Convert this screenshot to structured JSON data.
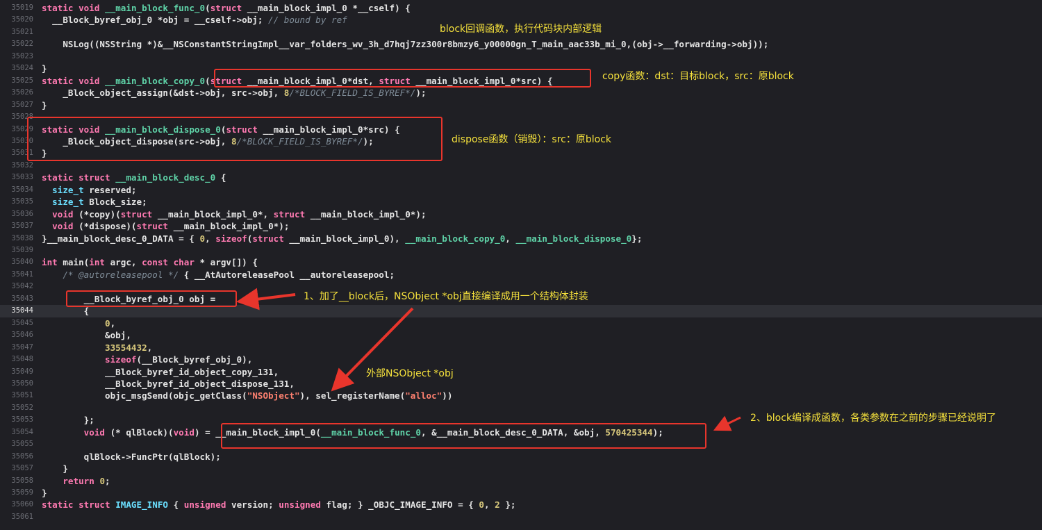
{
  "editor": {
    "current_line": "35044",
    "lines": [
      {
        "num": "35019",
        "code": "static void __main_block_func_0(struct __main_block_impl_0 *__cself) {"
      },
      {
        "num": "35020",
        "code": "  __Block_byref_obj_0 *obj = __cself->obj; // bound by ref"
      },
      {
        "num": "35021",
        "code": ""
      },
      {
        "num": "35022",
        "code": "    NSLog((NSString *)&__NSConstantStringImpl__var_folders_wv_3h_d7hqj7zz300r8bmzy6_y00000gn_T_main_aac33b_mi_0,(obj->__forwarding->obj));"
      },
      {
        "num": "35023",
        "code": ""
      },
      {
        "num": "35024",
        "code": "}"
      },
      {
        "num": "35025",
        "code": "static void __main_block_copy_0(struct __main_block_impl_0*dst, struct __main_block_impl_0*src) {"
      },
      {
        "num": "35026",
        "code": "    _Block_object_assign(&dst->obj, src->obj, 8/*BLOCK_FIELD_IS_BYREF*/);"
      },
      {
        "num": "35027",
        "code": "}"
      },
      {
        "num": "35028",
        "code": ""
      },
      {
        "num": "35029",
        "code": "static void __main_block_dispose_0(struct __main_block_impl_0*src) {"
      },
      {
        "num": "35030",
        "code": "    _Block_object_dispose(src->obj, 8/*BLOCK_FIELD_IS_BYREF*/);"
      },
      {
        "num": "35031",
        "code": "}"
      },
      {
        "num": "35032",
        "code": ""
      },
      {
        "num": "35033",
        "code": "static struct __main_block_desc_0 {"
      },
      {
        "num": "35034",
        "code": "  size_t reserved;"
      },
      {
        "num": "35035",
        "code": "  size_t Block_size;"
      },
      {
        "num": "35036",
        "code": "  void (*copy)(struct __main_block_impl_0*, struct __main_block_impl_0*);"
      },
      {
        "num": "35037",
        "code": "  void (*dispose)(struct __main_block_impl_0*);"
      },
      {
        "num": "35038",
        "code": "}__main_block_desc_0_DATA = { 0, sizeof(struct __main_block_impl_0), __main_block_copy_0, __main_block_dispose_0};"
      },
      {
        "num": "35039",
        "code": ""
      },
      {
        "num": "35040",
        "code": "int main(int argc, const char * argv[]) {"
      },
      {
        "num": "35041",
        "code": "    /* @autoreleasepool */ { __AtAutoreleasePool __autoreleasepool;"
      },
      {
        "num": "35042",
        "code": ""
      },
      {
        "num": "35043",
        "code": "        __Block_byref_obj_0 obj ="
      },
      {
        "num": "35044",
        "code": "        {"
      },
      {
        "num": "35045",
        "code": "            0,"
      },
      {
        "num": "35046",
        "code": "            &obj,"
      },
      {
        "num": "35047",
        "code": "            33554432,"
      },
      {
        "num": "35048",
        "code": "            sizeof(__Block_byref_obj_0),"
      },
      {
        "num": "35049",
        "code": "            __Block_byref_id_object_copy_131,"
      },
      {
        "num": "35050",
        "code": "            __Block_byref_id_object_dispose_131,"
      },
      {
        "num": "35051",
        "code": "            objc_msgSend(objc_getClass(\"NSObject\"), sel_registerName(\"alloc\"))"
      },
      {
        "num": "35052",
        "code": ""
      },
      {
        "num": "35053",
        "code": "        };"
      },
      {
        "num": "35054",
        "code": "        void (* qlBlock)(void) = __main_block_impl_0(__main_block_func_0, &__main_block_desc_0_DATA, &obj, 570425344);"
      },
      {
        "num": "35055",
        "code": ""
      },
      {
        "num": "35056",
        "code": "        qlBlock->FuncPtr(qlBlock);"
      },
      {
        "num": "35057",
        "code": "    }"
      },
      {
        "num": "35058",
        "code": "    return 0;"
      },
      {
        "num": "35059",
        "code": "}"
      },
      {
        "num": "35060",
        "code": "static struct IMAGE_INFO { unsigned version; unsigned flag; } _OBJC_IMAGE_INFO = { 0, 2 };"
      },
      {
        "num": "35061",
        "code": ""
      }
    ]
  },
  "annotations": {
    "func_note": "block回调函数，执行代码块内部逻辑",
    "copy_note": "copy函数：dst：目标block，src：原block",
    "dispose_note": "dispose函数（销毁）：src：原block",
    "byref_note": "1、加了__block后，NSObject *obj直接编译成用一个结构体封装",
    "outer_note": "外部NSObject *obj",
    "impl_note": "2、block编译成函数，各类参数在之前的步骤已经说明了"
  },
  "theme": {
    "background": "#1f1f24",
    "keyword": "#ff7ab2",
    "function_name": "#5fd3a8",
    "type_name": "#6bdfff",
    "comment": "#7f8c98",
    "number": "#d9c97c",
    "string": "#ff8170",
    "annotation_text": "#f5e13c",
    "highlight_box": "#e8352c"
  }
}
